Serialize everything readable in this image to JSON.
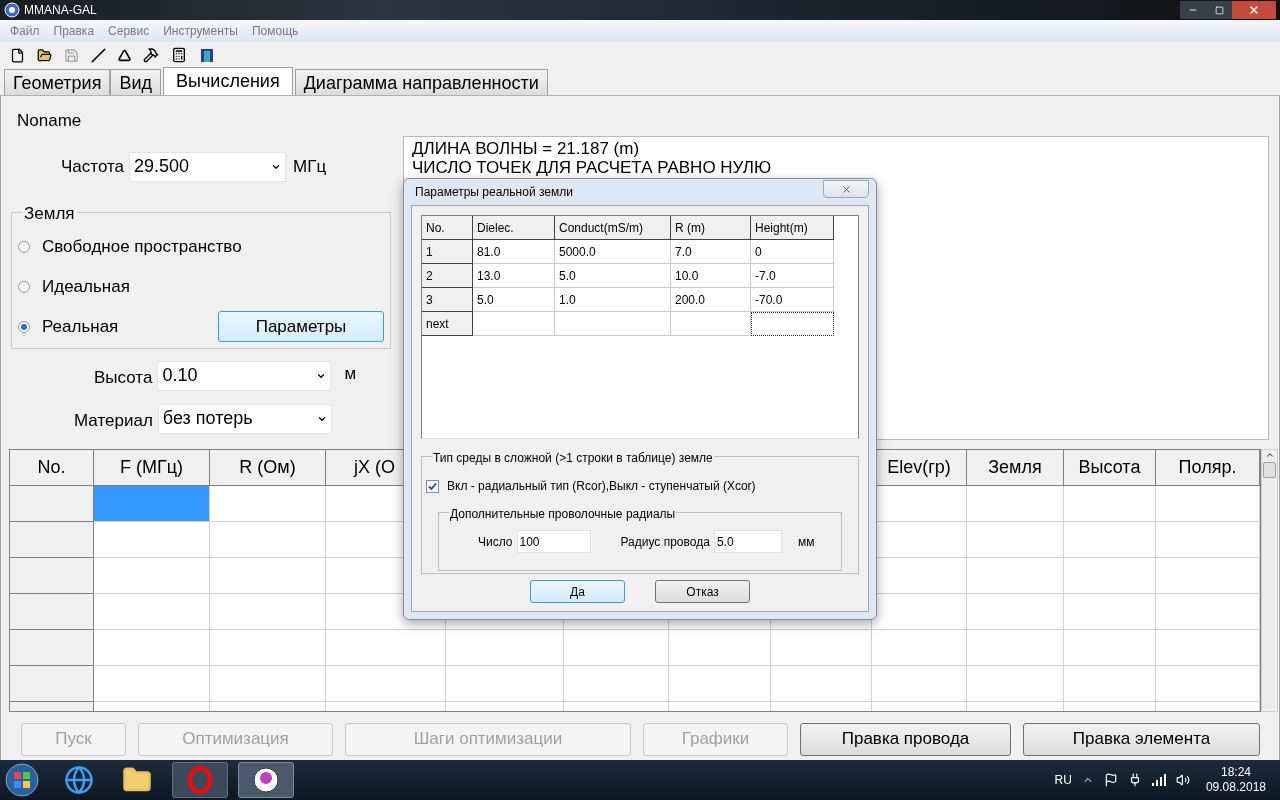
{
  "window": {
    "title": "MMANA-GAL"
  },
  "menu": [
    "Файл",
    "Правка",
    "Сервис",
    "Инструменты",
    "Помощь"
  ],
  "tabs": [
    {
      "label": "Геометрия",
      "selected": false
    },
    {
      "label": "Вид",
      "selected": false
    },
    {
      "label": "Вычисления",
      "selected": true
    },
    {
      "label": "Диаграмма направленности",
      "selected": false
    }
  ],
  "project_name": "Noname",
  "frequency": {
    "label": "Частота",
    "value": "29.500",
    "unit": "МГц"
  },
  "ground": {
    "title": "Земля",
    "options": [
      {
        "label": "Свободное пространство",
        "selected": false
      },
      {
        "label": "Идеальная",
        "selected": false
      },
      {
        "label": "Реальная",
        "selected": true
      }
    ],
    "params_button": "Параметры"
  },
  "height": {
    "label": "Высота",
    "value": "0.10",
    "unit": "м"
  },
  "material": {
    "label": "Материал",
    "value": "без потерь"
  },
  "output_lines": [
    "ДЛИНА ВОЛНЫ = 21.187 (m)",
    "ЧИСЛО ТОЧЕК ДЛЯ РАСЧЕТА РАВНО НУЛЮ"
  ],
  "results_table": {
    "columns_left": [
      "No.",
      "F (МГц)",
      "R (Ом)",
      "jX (О"
    ],
    "columns_right": [
      "Elev(гр)",
      "Земля",
      "Высота",
      "Поляр."
    ],
    "rows": [
      {
        "selected": true
      },
      {
        "selected": false
      },
      {
        "selected": false
      },
      {
        "selected": false
      },
      {
        "selected": false
      },
      {
        "selected": false
      },
      {
        "selected": false
      }
    ]
  },
  "buttons": [
    {
      "label": "Пуск",
      "disabled": true
    },
    {
      "label": "Оптимизация",
      "disabled": true
    },
    {
      "label": "Шаги оптимизации",
      "disabled": true
    },
    {
      "label": "Графики",
      "disabled": true
    },
    {
      "label": "Правка провода",
      "disabled": false
    },
    {
      "label": "Правка элемента",
      "disabled": false
    }
  ],
  "dialog": {
    "title": "Параметры реальной земли",
    "table": {
      "columns": [
        "No.",
        "Dielec.",
        "Conduct(mS/m)",
        "R (m)",
        "Height(m)"
      ],
      "rows": [
        [
          "1",
          "81.0",
          "5000.0",
          "7.0",
          "0"
        ],
        [
          "2",
          "13.0",
          "5.0",
          "10.0",
          "-7.0"
        ],
        [
          "3",
          "5.0",
          "1.0",
          "200.0",
          "-70.0"
        ],
        [
          "next"
        ]
      ]
    },
    "medium_group": {
      "title": "Тип среды в сложной (>1 строки в таблице) земле",
      "checkbox": {
        "label": "Вкл - радиальный тип (Rcor),Выкл - ступенчатый (Xcor)",
        "checked": true
      },
      "radials": {
        "title": "Дополнительные проволочные радиалы",
        "count_label": "Число",
        "count": "100",
        "radius_label": "Радиус провода",
        "radius": "5.0",
        "unit": "мм"
      }
    },
    "buttons": [
      "Да",
      "Отказ"
    ]
  },
  "taskbar": {
    "language": "RU",
    "time": "18:24",
    "date": "09.08.2018"
  }
}
